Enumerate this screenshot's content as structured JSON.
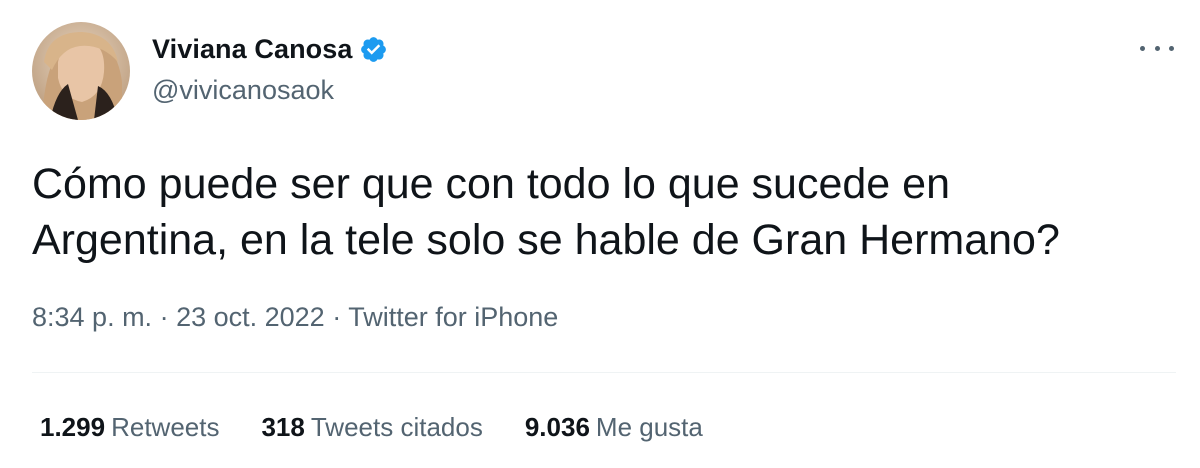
{
  "author": {
    "name": "Viviana Canosa",
    "handle": "@vivicanosaok",
    "verified_icon": "verified-badge-icon"
  },
  "tweet": {
    "text": "Cómo puede ser que con todo lo que sucede en\nArgentina, en la tele solo se hable de Gran Hermano?"
  },
  "meta": {
    "time": "8:34 p. m.",
    "separator1": " · ",
    "date": "23 oct. 2022",
    "separator2": " · ",
    "source": "Twitter for iPhone"
  },
  "stats": [
    {
      "count": "1.299",
      "label": "Retweets"
    },
    {
      "count": "318",
      "label": "Tweets citados"
    },
    {
      "count": "9.036",
      "label": "Me gusta"
    }
  ],
  "colors": {
    "text_primary": "#0f1419",
    "text_secondary": "#536471",
    "verified_blue": "#1d9bf0",
    "divider": "#eff3f4"
  }
}
